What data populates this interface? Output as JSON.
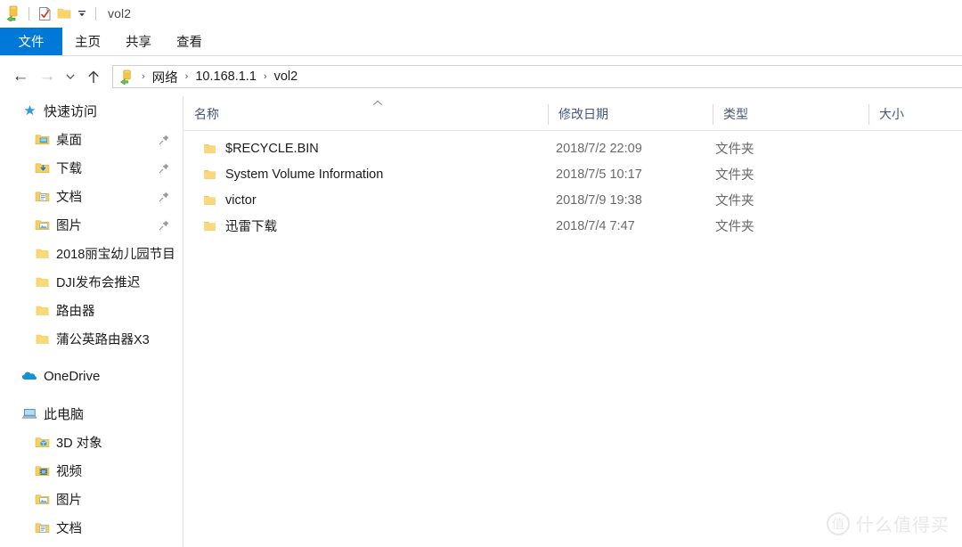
{
  "titlebar": {
    "title": "vol2",
    "icons": [
      {
        "name": "network-drive-icon"
      },
      {
        "name": "properties-icon"
      },
      {
        "name": "new-folder-icon"
      },
      {
        "name": "customize-quick-access-caret-icon"
      }
    ]
  },
  "ribbon": {
    "tabs": [
      {
        "label": "文件",
        "active": true
      },
      {
        "label": "主页",
        "active": false
      },
      {
        "label": "共享",
        "active": false
      },
      {
        "label": "查看",
        "active": false
      }
    ],
    "accent_color": "#0078d7"
  },
  "addressbar": {
    "back_label": "←",
    "forward_label": "→",
    "recent_label": "⌄",
    "up_label": "↑",
    "crumbs": [
      "网络",
      "10.168.1.1",
      "vol2"
    ],
    "separator": "›"
  },
  "navpane": {
    "sections": [
      {
        "name": "quick-access",
        "root": {
          "label": "快速访问",
          "icon": "star-icon"
        },
        "items": [
          {
            "label": "桌面",
            "icon": "desktop-folder-icon",
            "pinned": true
          },
          {
            "label": "下载",
            "icon": "downloads-folder-icon",
            "pinned": true
          },
          {
            "label": "文档",
            "icon": "documents-folder-icon",
            "pinned": true
          },
          {
            "label": "图片",
            "icon": "pictures-folder-icon",
            "pinned": true
          },
          {
            "label": "2018丽宝幼儿园节目",
            "icon": "folder-icon",
            "pinned": false
          },
          {
            "label": "DJI发布会推迟",
            "icon": "folder-icon",
            "pinned": false
          },
          {
            "label": "路由器",
            "icon": "folder-icon",
            "pinned": false
          },
          {
            "label": "蒲公英路由器X3",
            "icon": "folder-icon",
            "pinned": false
          }
        ]
      },
      {
        "name": "onedrive",
        "root": {
          "label": "OneDrive",
          "icon": "onedrive-cloud-icon"
        },
        "items": []
      },
      {
        "name": "this-pc",
        "root": {
          "label": "此电脑",
          "icon": "this-pc-icon"
        },
        "items": [
          {
            "label": "3D 对象",
            "icon": "3d-objects-folder-icon",
            "pinned": false
          },
          {
            "label": "视频",
            "icon": "videos-folder-icon",
            "pinned": false
          },
          {
            "label": "图片",
            "icon": "pictures-folder-icon",
            "pinned": false
          },
          {
            "label": "文档",
            "icon": "documents-folder-icon",
            "pinned": false
          }
        ]
      }
    ]
  },
  "filelist": {
    "columns": [
      {
        "key": "name",
        "label": "名称",
        "sorted": "asc"
      },
      {
        "key": "date",
        "label": "修改日期",
        "sorted": ""
      },
      {
        "key": "type",
        "label": "类型",
        "sorted": ""
      },
      {
        "key": "size",
        "label": "大小",
        "sorted": ""
      }
    ],
    "sort_caret": "˄",
    "rows": [
      {
        "name": "$RECYCLE.BIN",
        "date": "2018/7/2 22:09",
        "type": "文件夹",
        "size": ""
      },
      {
        "name": "System Volume Information",
        "date": "2018/7/5 10:17",
        "type": "文件夹",
        "size": ""
      },
      {
        "name": "victor",
        "date": "2018/7/9 19:38",
        "type": "文件夹",
        "size": ""
      },
      {
        "name": "迅雷下载",
        "date": "2018/7/4 7:47",
        "type": "文件夹",
        "size": ""
      }
    ]
  },
  "watermark": {
    "logo_char": "值",
    "text": "什么值得买"
  }
}
